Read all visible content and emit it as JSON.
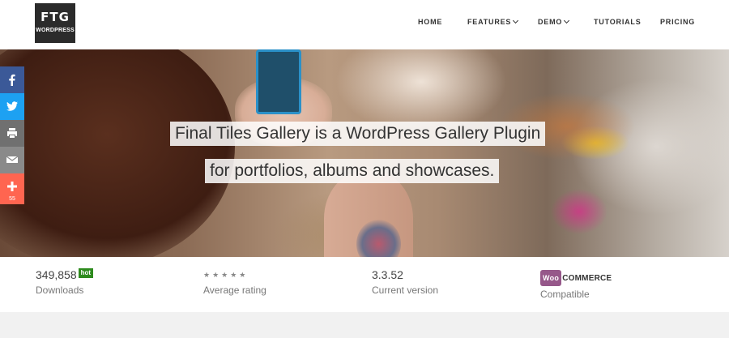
{
  "logo": {
    "main": "FTG",
    "sub": "WORDPRESS"
  },
  "nav": [
    {
      "label": "HOME",
      "dropdown": false
    },
    {
      "label": "FEATURES",
      "dropdown": true
    },
    {
      "label": "DEMO",
      "dropdown": true
    },
    {
      "label": "TUTORIALS",
      "dropdown": false
    },
    {
      "label": "PRICING",
      "dropdown": false
    }
  ],
  "hero": {
    "line1": "Final Tiles Gallery is a WordPress Gallery Plugin",
    "line2": "for portfolios, albums and showcases."
  },
  "share": {
    "buttons": [
      {
        "icon": "facebook-icon",
        "color": "#3b5998"
      },
      {
        "icon": "twitter-icon",
        "color": "#1da1f2"
      },
      {
        "icon": "print-icon",
        "color": "#707070"
      },
      {
        "icon": "email-icon",
        "color": "#8a8a8a"
      },
      {
        "icon": "plus-icon",
        "color": "#ff6550"
      }
    ],
    "count": "55"
  },
  "stats": {
    "downloads": {
      "value": "349,858",
      "badge": "hot",
      "label": "Downloads"
    },
    "rating": {
      "stars": "★★★★★",
      "label": "Average rating"
    },
    "version": {
      "value": "3.3.52",
      "label": "Current version"
    },
    "woo": {
      "badge": "Woo",
      "text": "COMMERCE",
      "label": "Compatible"
    }
  }
}
